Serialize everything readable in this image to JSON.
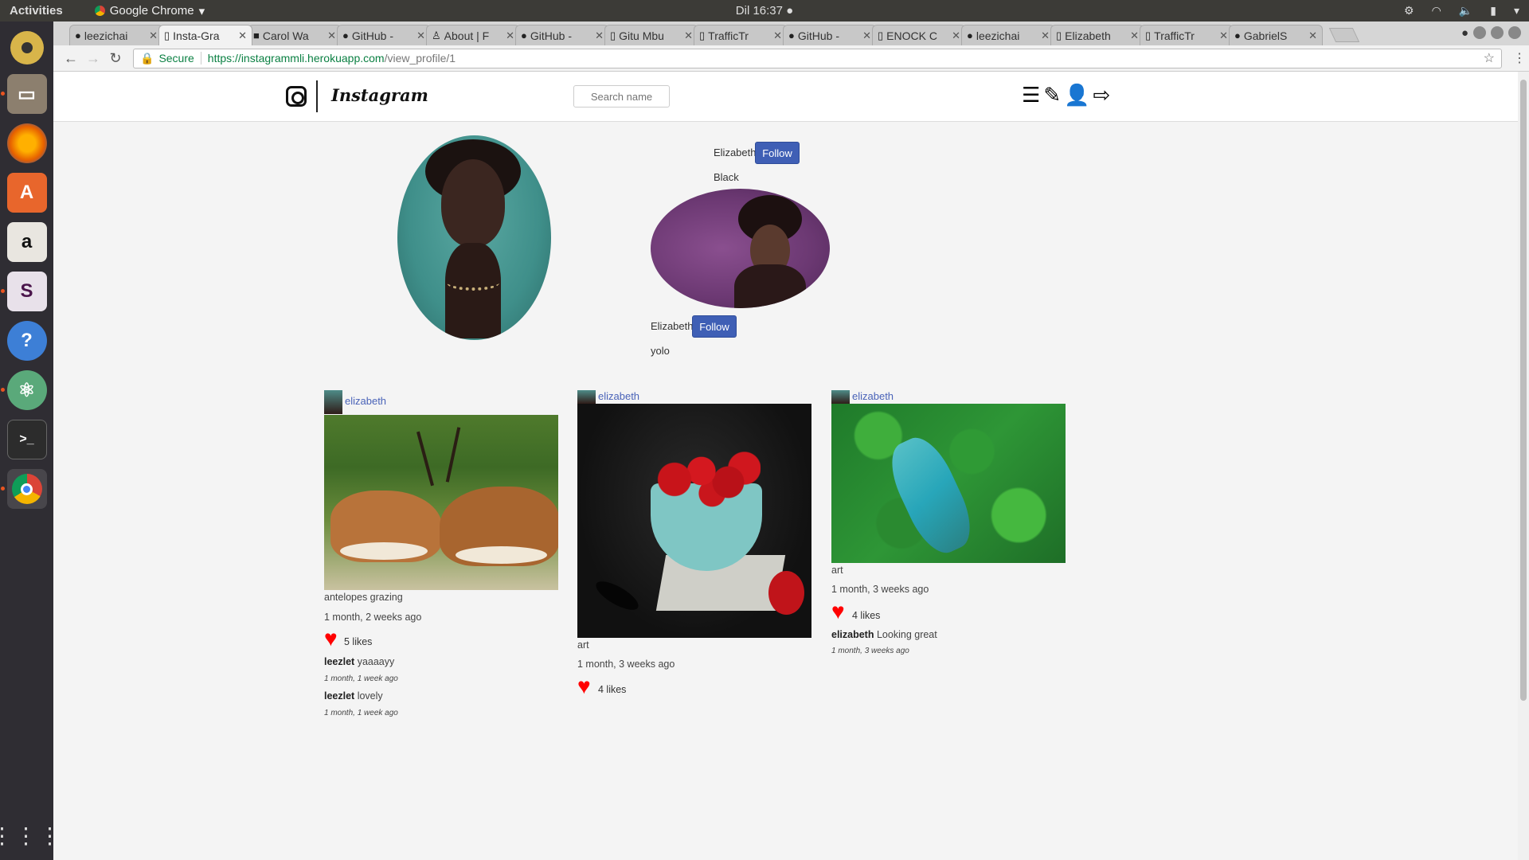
{
  "desktop": {
    "activities": "Activities",
    "app_name": "Google Chrome",
    "clock": "Dil 16:37"
  },
  "browser": {
    "tabs": [
      {
        "label": "leezichai",
        "icon": "github-icon"
      },
      {
        "label": "Insta-Gra",
        "icon": "page-icon",
        "active": true
      },
      {
        "label": "Carol Wa",
        "icon": "dark-square-icon"
      },
      {
        "label": "GitHub -",
        "icon": "github-icon"
      },
      {
        "label": "About | F",
        "icon": "user-icon"
      },
      {
        "label": "GitHub -",
        "icon": "github-icon"
      },
      {
        "label": "Gitu Mbu",
        "icon": "page-icon"
      },
      {
        "label": "TrafficTr",
        "icon": "page-icon"
      },
      {
        "label": "GitHub -",
        "icon": "github-icon"
      },
      {
        "label": "ENOCK C",
        "icon": "page-icon"
      },
      {
        "label": "leezichai",
        "icon": "github-icon"
      },
      {
        "label": "Elizabeth",
        "icon": "page-icon"
      },
      {
        "label": "TrafficTr",
        "icon": "page-icon"
      },
      {
        "label": "GabrielS",
        "icon": "github-icon"
      }
    ],
    "secure_label": "Secure",
    "url_host": "https://instagrammli.herokuapp.com",
    "url_path": "/view_profile/1"
  },
  "site": {
    "brand": "Instagram",
    "search_placeholder": "Search name"
  },
  "profile": {
    "name1": "Elizabeth",
    "follow1": "Follow",
    "bio1": "Black",
    "name2": "Elizabeth",
    "follow2": "Follow",
    "bio2": "yolo"
  },
  "posts": [
    {
      "user": "elizabeth",
      "caption": "antelopes grazing",
      "time": "1 month, 2 weeks ago",
      "likes": "5 likes",
      "comments": [
        {
          "user": "leezlet",
          "text": "yaaaayy",
          "time": "1 month, 1 week ago"
        },
        {
          "user": "leezlet",
          "text": "lovely",
          "time": "1 month, 1 week ago"
        }
      ]
    },
    {
      "user": "elizabeth",
      "caption": "art",
      "time": "1 month, 3 weeks ago",
      "likes": "4 likes",
      "comments": []
    },
    {
      "user": "elizabeth",
      "caption": "art",
      "time": "1 month, 3 weeks ago",
      "likes": "4 likes",
      "comments": [
        {
          "user": "elizabeth",
          "text": "Looking great",
          "time": "1 month, 3 weeks ago"
        }
      ]
    }
  ],
  "colors": {
    "accent": "#3f5fb5",
    "link": "#4a63b8",
    "heart": "#ff0000"
  }
}
